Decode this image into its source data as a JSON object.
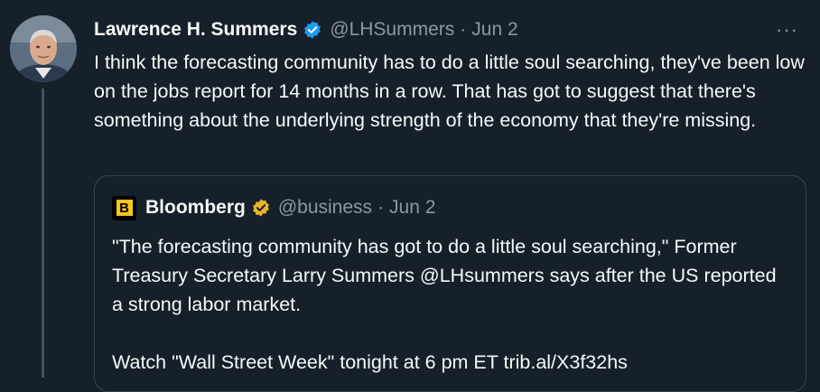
{
  "tweet": {
    "author_name": "Lawrence H. Summers",
    "handle": "@LHSummers",
    "separator": "·",
    "date": "Jun 2",
    "more_label": "···",
    "text": "I think the forecasting community has to do a little soul searching, they've been low on the jobs report for 14 months in a row. That has got to suggest that there's something about the underlying strength of the economy that they're missing.",
    "verified_icon": "blue-verified-badge-icon",
    "colors": {
      "background": "#15202b",
      "text": "#f7f9f9",
      "muted": "#8b98a5",
      "verified_blue": "#1d9bf0"
    }
  },
  "quote": {
    "author_name": "Bloomberg",
    "logo_letter": "B",
    "handle": "@business",
    "separator": "·",
    "date": "Jun 2",
    "verified_icon": "gold-verified-badge-icon",
    "paragraph_1": "\"The forecasting community has got to do a little soul searching,\" Former Treasury Secretary Larry Summers @LHsummers says after the US reported a strong labor market.",
    "paragraph_2": "Watch \"Wall Street Week\" tonight at 6 pm ET trib.al/X3f32hs",
    "colors": {
      "border": "#38444d",
      "logo_yellow": "#f5c518",
      "verified_gold": "#e8b32c"
    }
  }
}
